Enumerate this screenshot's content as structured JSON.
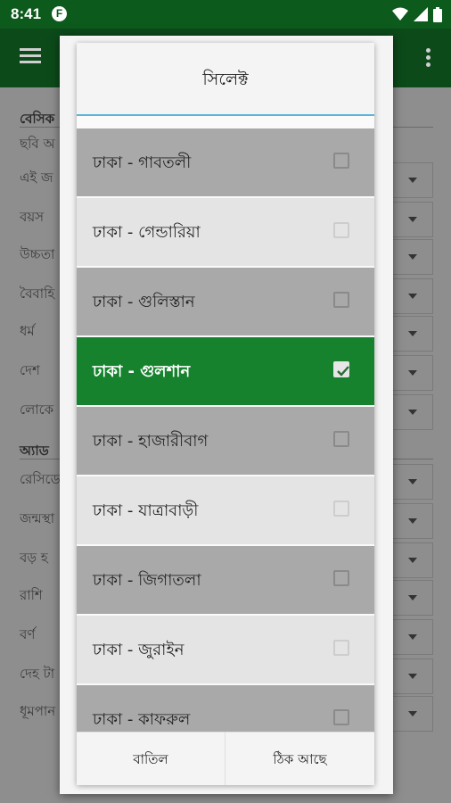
{
  "status_bar": {
    "time": "8:41",
    "app_icon_letter": "F"
  },
  "background": {
    "sections": [
      {
        "title": "বেসিক",
        "items": [
          "ছবি অ",
          "এই জ",
          "বয়স",
          "উচ্চতা",
          "বৈবাহি",
          "ধর্ম",
          "দেশ",
          "লোকে"
        ]
      },
      {
        "title": "অ্যাড",
        "items": [
          "রেসিডে",
          "জন্মস্থা",
          "বড় হ",
          "রাশি",
          "বর্ণ",
          "দেহ টা",
          "ধূমপান"
        ]
      }
    ]
  },
  "dialog": {
    "title": "সিলেক্ট",
    "options": [
      {
        "label": "ঢাকা - গাবতলী",
        "checked": false
      },
      {
        "label": "ঢাকা - গেন্ডারিয়া",
        "checked": false
      },
      {
        "label": "ঢাকা - গুলিস্তান",
        "checked": false
      },
      {
        "label": "ঢাকা - গুলশান",
        "checked": true
      },
      {
        "label": "ঢাকা - হাজারীবাগ",
        "checked": false
      },
      {
        "label": "ঢাকা - যাত্রাবাড়ী",
        "checked": false
      },
      {
        "label": "ঢাকা - জিগাতলা",
        "checked": false
      },
      {
        "label": "ঢাকা - জুরাইন",
        "checked": false
      },
      {
        "label": "ঢাকা - কাফরুল",
        "checked": false
      }
    ],
    "cancel_label": "বাতিল",
    "ok_label": "ঠিক আছে"
  },
  "colors": {
    "primary": "#0c4a1a",
    "selected": "#16822d",
    "title_underline": "#5ab5d8"
  }
}
